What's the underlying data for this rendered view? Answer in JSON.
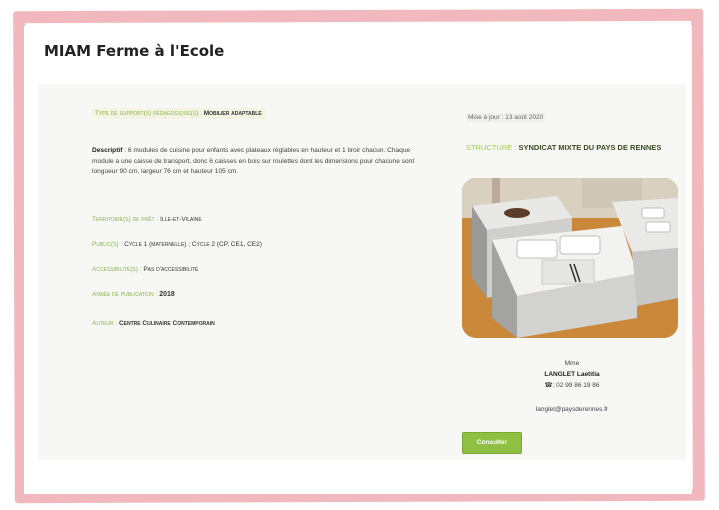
{
  "page": {
    "title": "MIAM Ferme à l'Ecole"
  },
  "resource": {
    "type_label": "Type de support(s) pédagogique(s)",
    "type_value": "Mobilier adaptable",
    "description_label": "Descriptif",
    "description_text": " : 6 modules de cuisine pour enfants avec plateaux réglables en hauteur et 1 tiroir chacun. Chaque module a une caisse de transport, donc 6 caisses en bois sur roulettes dont les dimensions pour chacune sont longueur 90 cm, largeur 76 cm et hauteur 105 cm.",
    "territory_label": "Territoire(s) de prêt",
    "territory_value": "Ille-et-Vilaine",
    "audience_label": "Public(s)",
    "audience_value": "Cycle 1 (maternelle) ; Cycle 2 (CP, CE1, CE2)",
    "accessibility_label": "Accessibilité(s)",
    "accessibility_value": "Pas d'accessibilité",
    "year_label": "Année de publication",
    "year_value": "2018",
    "author_label": "Auteur",
    "author_value": "Centre Culinaire Contemporain"
  },
  "sidebar": {
    "updated": "Mise à jour : 13 août 2020",
    "structure_label": "STRUCTURE :",
    "structure_value": "SYNDICAT MIXTE DU PAYS DE RENNES",
    "contact_title": "Mme",
    "contact_name": "LANGLET Laetitia",
    "contact_phone": ": 02 99 86 19 86",
    "contact_email": "langlet@paysderennes.fr",
    "button_label": "Consulter"
  },
  "colors": {
    "accent": "#8fc043",
    "frame": "#f1b9bd"
  }
}
